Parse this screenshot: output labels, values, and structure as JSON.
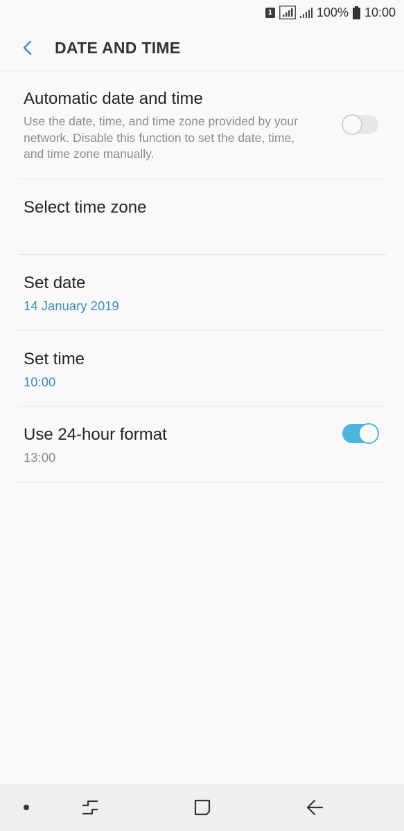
{
  "status_bar": {
    "sim_label": "1",
    "battery": "100%",
    "clock": "10:00",
    "icons": [
      "sim-1-icon",
      "signal-icon",
      "signal-weak-icon",
      "battery-icon"
    ]
  },
  "header": {
    "back_icon": "chevron-left-icon",
    "title": "DATE AND TIME"
  },
  "settings": {
    "auto": {
      "title": "Automatic date and time",
      "description": "Use the date, time, and time zone provided by your network. Disable this function to set the date, time, and time zone manually.",
      "enabled": false
    },
    "timezone": {
      "title": "Select time zone"
    },
    "date": {
      "title": "Set date",
      "value": "14 January 2019"
    },
    "time": {
      "title": "Set time",
      "value": "10:00"
    },
    "hour24": {
      "title": "Use 24-hour format",
      "value": "13:00",
      "enabled": true
    }
  },
  "nav_bar": {
    "icons": [
      "dot-icon",
      "recent-apps-icon",
      "home-icon",
      "back-arrow-icon"
    ]
  },
  "colors": {
    "accent": "#4cb6dc",
    "value_blue": "#3d8eb9",
    "background": "#f9f9f9"
  }
}
